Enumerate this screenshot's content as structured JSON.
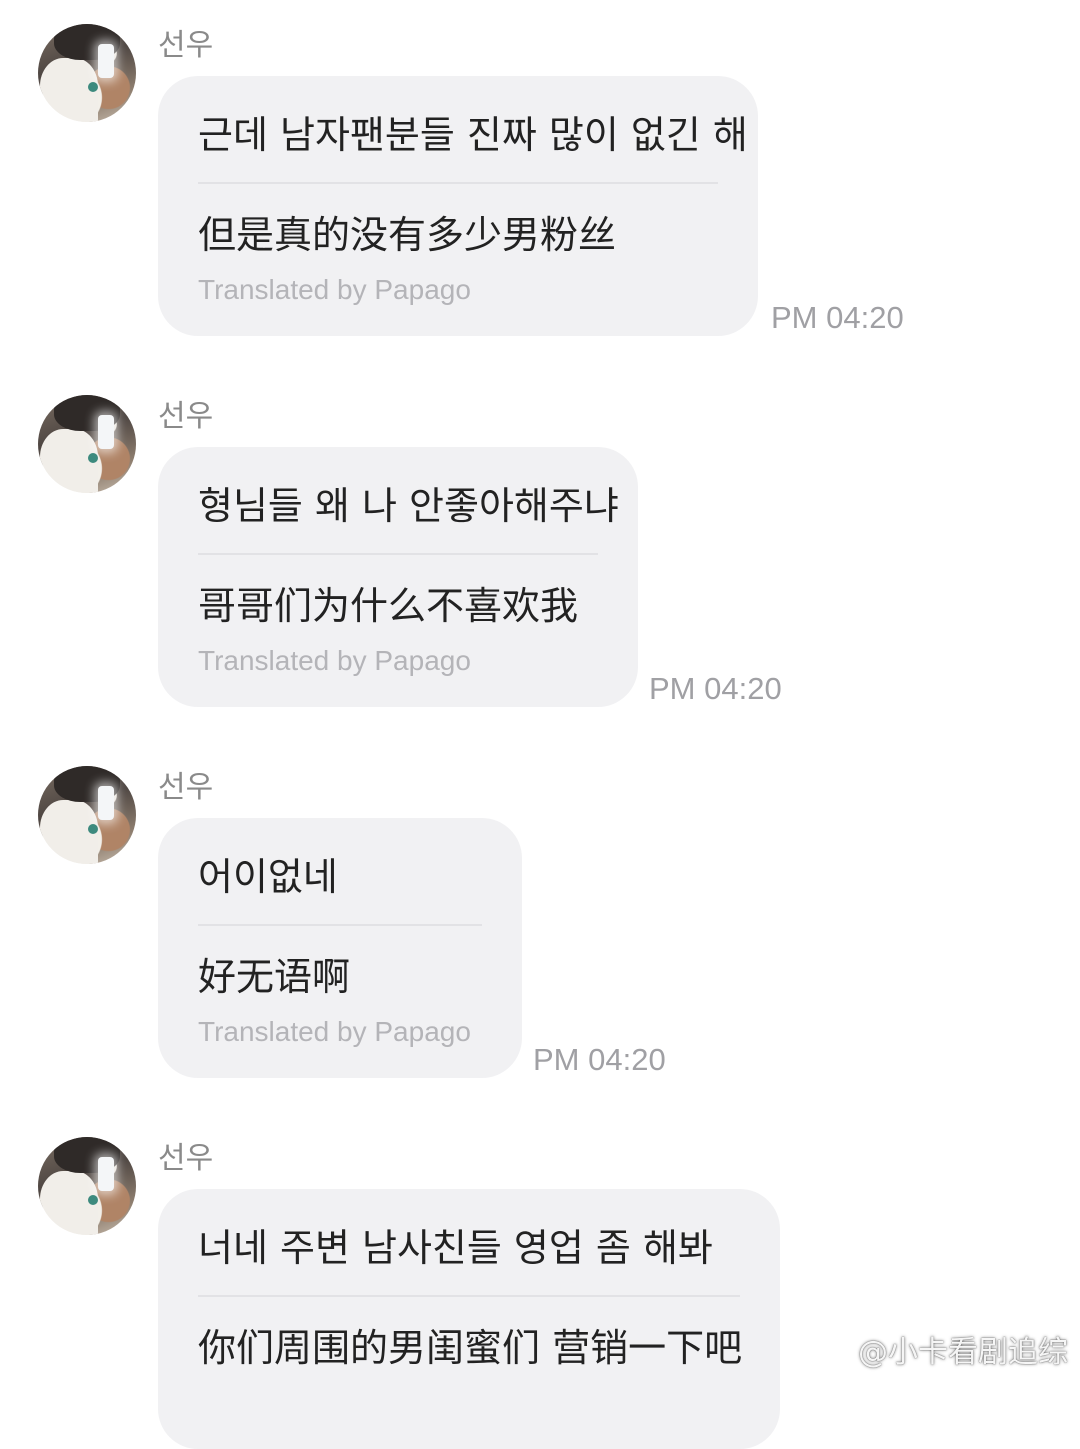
{
  "messages": [
    {
      "sender": "선우",
      "original": "근데 남자팬분들 진짜 많이 없긴 해",
      "translation": "但是真的没有多少男粉丝",
      "credit": "Translated by Papago",
      "time": "PM 04:20"
    },
    {
      "sender": "선우",
      "original": "형님들 왜 나 안좋아해주냐",
      "translation": "哥哥们为什么不喜欢我",
      "credit": "Translated by Papago",
      "time": "PM 04:20"
    },
    {
      "sender": "선우",
      "original": "어이없네",
      "translation": "好无语啊",
      "credit": "Translated by Papago",
      "time": "PM 04:20"
    },
    {
      "sender": "선우",
      "original": "너네 주변 남사친들 영업 좀 해봐",
      "translation": "你们周围的男闺蜜们 营销一下吧",
      "credit": "",
      "time": ""
    }
  ],
  "watermark": {
    "text": "@小卡看剧追综",
    "icon": "weibo-icon"
  }
}
